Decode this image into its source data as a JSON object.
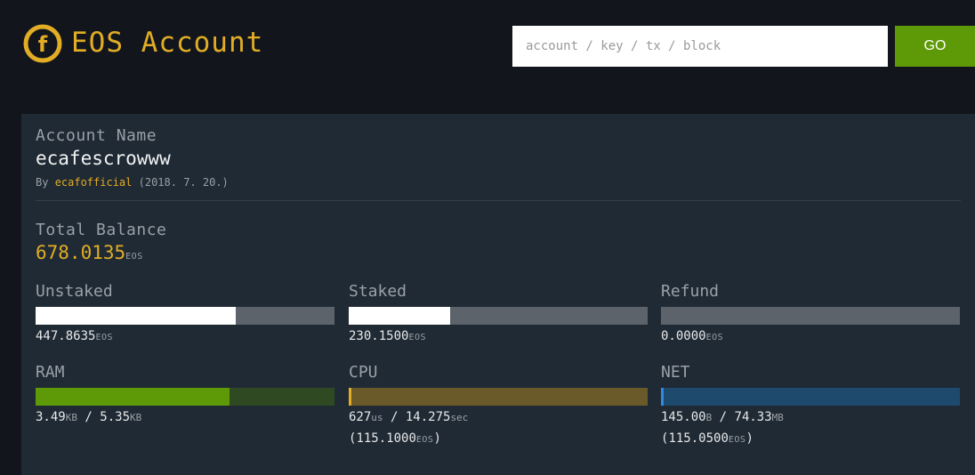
{
  "header": {
    "logo_glyph": "f",
    "title": "EOS Account",
    "search_placeholder": "account / key / tx / block",
    "go_label": "GO"
  },
  "account": {
    "label": "Account Name",
    "name": "ecafescrowww",
    "by_prefix": "By",
    "creator": "ecafofficial",
    "created_date": "(2018. 7. 20.)"
  },
  "balance": {
    "label": "Total Balance",
    "value": "678.0135",
    "unit": "EOS"
  },
  "tokens": [
    {
      "label": "Unstaked",
      "value": "447.8635",
      "unit": "EOS",
      "fill": 0.67
    },
    {
      "label": "Staked",
      "value": "230.1500",
      "unit": "EOS",
      "fill": 0.34
    },
    {
      "label": "Refund",
      "value": "0.0000",
      "unit": "EOS",
      "fill": 0
    }
  ],
  "resources": {
    "ram": {
      "label": "RAM",
      "used": "3.49",
      "used_unit": "KB",
      "sep": "/",
      "total": "5.35",
      "total_unit": "KB",
      "fill": 0.65
    },
    "cpu": {
      "label": "CPU",
      "used": "627",
      "used_unit": "us",
      "sep": "/",
      "total": "14.275",
      "total_unit": "sec",
      "stake_open": "(",
      "stake": "115.1000",
      "stake_unit": "EOS",
      "stake_close": ")",
      "fill": 0.01
    },
    "net": {
      "label": "NET",
      "used": "145.00",
      "used_unit": "B",
      "sep": "/",
      "total": "74.33",
      "total_unit": "MB",
      "stake_open": "(",
      "stake": "115.0500",
      "stake_unit": "EOS",
      "stake_close": ")",
      "fill": 0.01
    }
  },
  "colors": {
    "accent": "#e2ad25",
    "go_button": "#5e9a07",
    "bar_track": "#5c636b",
    "bar_fill": "#ffffff",
    "ram_fill": "#5e9a07",
    "ram_track": "#2f4a22",
    "cpu_fill": "#e2ad25",
    "cpu_track": "#6a5a2a",
    "net_fill": "#2e8be0",
    "net_track": "#1e4a6e"
  }
}
